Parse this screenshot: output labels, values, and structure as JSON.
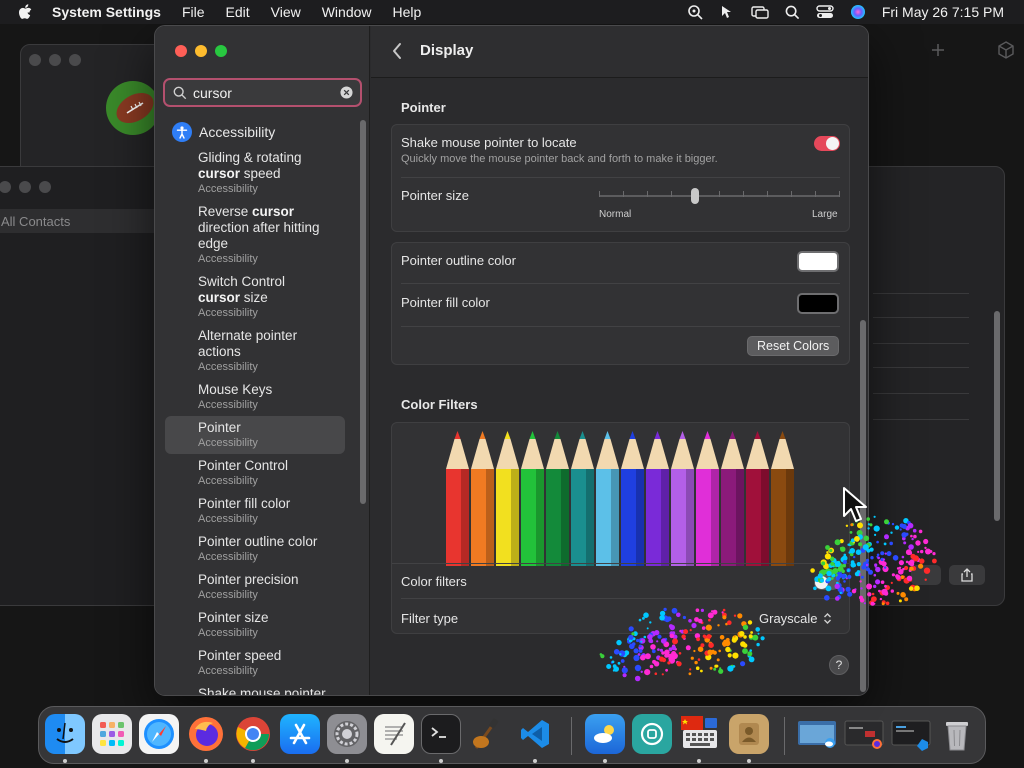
{
  "menubar": {
    "app_name": "System Settings",
    "items": [
      "File",
      "Edit",
      "View",
      "Window",
      "Help"
    ],
    "clock": "Fri May 26  7:15 PM"
  },
  "background": {
    "contacts_label": "All Contacts"
  },
  "sidebar": {
    "search_value": "cursor",
    "category": "Accessibility",
    "results": [
      {
        "pre": "Gliding & rotating",
        "hl": "cursor",
        "post": " speed",
        "sub": "Accessibility"
      },
      {
        "pre": "Reverse ",
        "hl": "cursor",
        "post": " direction after hitting edge",
        "sub": "Accessibility"
      },
      {
        "pre": "Switch Control",
        "hl": "cursor",
        "post": " size",
        "sub": "Accessibility"
      },
      {
        "pre": "Alternate pointer actions",
        "hl": "",
        "post": "",
        "sub": "Accessibility"
      },
      {
        "pre": "Mouse Keys",
        "hl": "",
        "post": "",
        "sub": "Accessibility"
      },
      {
        "pre": "Pointer",
        "hl": "",
        "post": "",
        "sub": "Accessibility"
      },
      {
        "pre": "Pointer Control",
        "hl": "",
        "post": "",
        "sub": "Accessibility"
      },
      {
        "pre": "Pointer fill color",
        "hl": "",
        "post": "",
        "sub": "Accessibility"
      },
      {
        "pre": "Pointer outline color",
        "hl": "",
        "post": "",
        "sub": "Accessibility"
      },
      {
        "pre": "Pointer precision",
        "hl": "",
        "post": "",
        "sub": "Accessibility"
      },
      {
        "pre": "Pointer size",
        "hl": "",
        "post": "",
        "sub": "Accessibility"
      },
      {
        "pre": "Pointer speed",
        "hl": "",
        "post": "",
        "sub": "Accessibility"
      },
      {
        "pre": "Shake mouse pointer",
        "hl": "",
        "post": "",
        "sub": ""
      }
    ]
  },
  "content": {
    "title": "Display",
    "pointer_section": "Pointer",
    "shake_label": "Shake mouse pointer to locate",
    "shake_desc": "Quickly move the mouse pointer back and forth to make it bigger.",
    "shake_on": true,
    "pointer_size_label": "Pointer size",
    "pointer_size_min": "Normal",
    "pointer_size_max": "Large",
    "pointer_size_value": 0.4,
    "outline_label": "Pointer outline color",
    "outline_color": "#ffffff",
    "fill_label": "Pointer fill color",
    "fill_color": "#000000",
    "reset_label": "Reset Colors",
    "filters_section": "Color Filters",
    "color_filters_label": "Color filters",
    "color_filters_on": false,
    "filter_type_label": "Filter type",
    "filter_type_value": "Grayscale",
    "help_label": "?"
  },
  "pencil_colors": [
    "#e8352f",
    "#f07a22",
    "#f2e01f",
    "#22c23a",
    "#138a3a",
    "#1a8f8f",
    "#5cc0e8",
    "#1f3fe0",
    "#7a2ad8",
    "#b35fe8",
    "#e02fd8",
    "#8b1a7a",
    "#a0103a",
    "#8a4a10"
  ],
  "colors": {
    "accent": "#e5485a",
    "search_border": "#b4506e"
  },
  "dock": {
    "apps": [
      "finder-icon",
      "launchpad-icon",
      "safari-icon",
      "firefox-icon",
      "chrome-icon",
      "app-store-icon",
      "system-settings-icon",
      "textedit-icon",
      "terminal-icon",
      "instruments-icon",
      "vscode-icon",
      "weather-icon",
      "screen-time-icon",
      "keyboard-viewer-icon",
      "contacts-icon",
      "window-thumbnail-icon",
      "window-thumbnail-icon",
      "window-thumbnail-icon",
      "trash-icon"
    ]
  }
}
